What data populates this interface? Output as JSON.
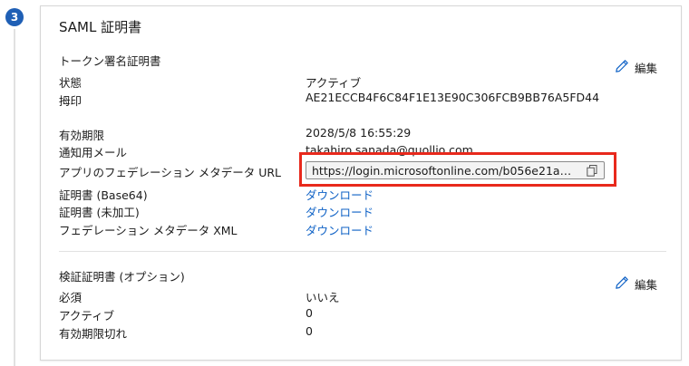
{
  "step": {
    "number": "3"
  },
  "card": {
    "title": "SAML 証明書"
  },
  "token_signing": {
    "section_title": "トークン署名証明書",
    "edit_label": "編集",
    "rows": [
      {
        "label": "状態",
        "value": "アクティブ"
      },
      {
        "label": "拇印",
        "value": "AE21ECCB4F6C84F1E13E90C306FCB9BB76A5FD44"
      },
      {
        "label": "有効期限",
        "value": "2028/5/8 16:55:29"
      },
      {
        "label": "通知用メール",
        "value": "takahiro.sanada@quollio.com"
      },
      {
        "label": "アプリのフェデレーション メタデータ URL",
        "value": "https://login.microsoftonline.com/b056e21a…"
      },
      {
        "label": "証明書 (Base64)",
        "value": "ダウンロード"
      },
      {
        "label": "証明書 (未加工)",
        "value": "ダウンロード"
      },
      {
        "label": "フェデレーション メタデータ XML",
        "value": "ダウンロード"
      }
    ]
  },
  "verification": {
    "section_title": "検証証明書 (オプション)",
    "edit_label": "編集",
    "rows": [
      {
        "label": "必須",
        "value": "いいえ"
      },
      {
        "label": "アクティブ",
        "value": "0"
      },
      {
        "label": "有効期限切れ",
        "value": "0"
      }
    ]
  },
  "colors": {
    "accent": "#0f62c6",
    "badge": "#1f5fb5",
    "highlight": "#e8291c"
  },
  "icons": {
    "edit": "pencil-icon",
    "copy": "copy-icon"
  }
}
